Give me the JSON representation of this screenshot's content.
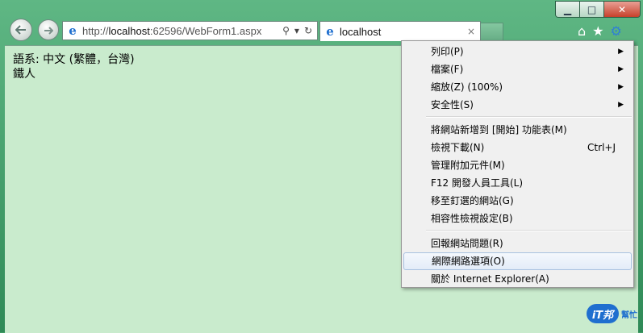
{
  "window": {
    "minimize": "▁",
    "maximize": "□",
    "close": "✕"
  },
  "nav": {
    "back_icon": "back-arrow",
    "forward_icon": "forward-arrow"
  },
  "address": {
    "prefix": "http://",
    "host": "localhost",
    "rest": ":62596/WebForm1.aspx",
    "search_icon": "⚲",
    "dropdown_icon": "▾",
    "refresh_icon": "↻"
  },
  "tab": {
    "title": "localhost",
    "close": "×"
  },
  "toolbar": {
    "home": "⌂",
    "favorites": "★",
    "tools": "⚙"
  },
  "page": {
    "line1": "語系: 中文 (繁體，台灣)",
    "line2": "鐵人"
  },
  "menu": {
    "items": [
      {
        "label": "列印(P)",
        "shortcut": "",
        "arrow": "▶"
      },
      {
        "label": "檔案(F)",
        "shortcut": "",
        "arrow": "▶"
      },
      {
        "label": "縮放(Z) (100%)",
        "shortcut": "",
        "arrow": "▶"
      },
      {
        "label": "安全性(S)",
        "shortcut": "",
        "arrow": "▶"
      },
      {
        "label": "將網站新增到 [開始] 功能表(M)",
        "shortcut": "",
        "arrow": ""
      },
      {
        "label": "檢視下載(N)",
        "shortcut": "Ctrl+J",
        "arrow": ""
      },
      {
        "label": "管理附加元件(M)",
        "shortcut": "",
        "arrow": ""
      },
      {
        "label": "F12 開發人員工具(L)",
        "shortcut": "",
        "arrow": ""
      },
      {
        "label": "移至釘選的網站(G)",
        "shortcut": "",
        "arrow": ""
      },
      {
        "label": "相容性檢視設定(B)",
        "shortcut": "",
        "arrow": ""
      },
      {
        "label": "回報網站問題(R)",
        "shortcut": "",
        "arrow": ""
      },
      {
        "label": "網際網路選項(O)",
        "shortcut": "",
        "arrow": ""
      },
      {
        "label": "關於 Internet Explorer(A)",
        "shortcut": "",
        "arrow": ""
      }
    ]
  },
  "watermark": {
    "logo": "iT邦",
    "text": "幫忙"
  }
}
